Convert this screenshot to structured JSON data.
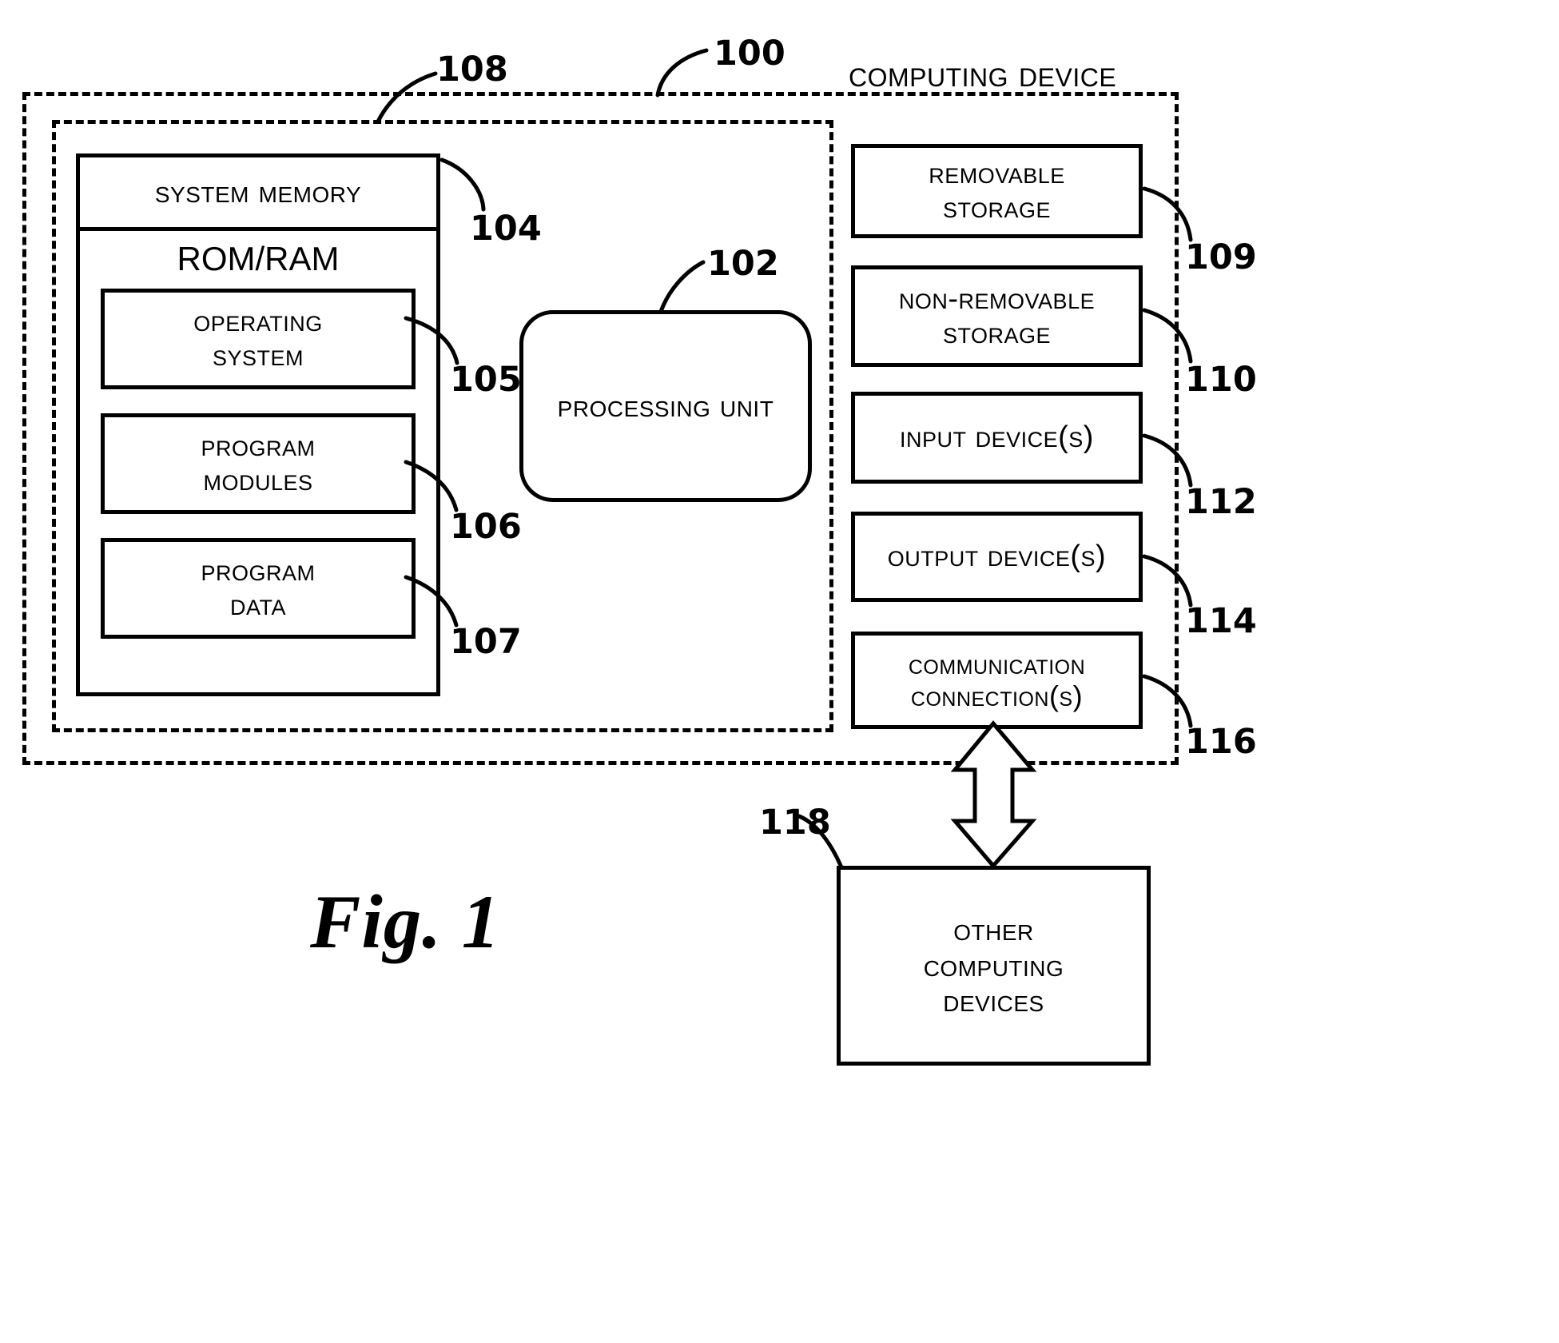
{
  "figure": {
    "caption": "Fig. 1",
    "device_label": "Computing Device"
  },
  "refs": {
    "device": "100",
    "processing_unit": "102",
    "system_memory": "104",
    "operating_system": "105",
    "program_modules": "106",
    "program_data": "107",
    "basic_configuration": "108",
    "removable_storage": "109",
    "non_removable_storage": "110",
    "input_devices": "112",
    "output_devices": "114",
    "communication_connections": "116",
    "other_computing_devices": "118"
  },
  "memory": {
    "title": "System Memory",
    "type": "ROM/RAM",
    "blocks": [
      {
        "label": "Operating System"
      },
      {
        "label": "Program Modules"
      },
      {
        "label": "Program Data"
      }
    ]
  },
  "processing_unit": {
    "label": "Processing Unit"
  },
  "peripherals": [
    {
      "label": "Removable Storage"
    },
    {
      "label": "Non-Removable Storage"
    },
    {
      "label": "Input Device(s)"
    },
    {
      "label": "Output Device(s)"
    },
    {
      "label": "Communication Connection(s)"
    }
  ],
  "external": {
    "label": "Other Computing Devices"
  }
}
